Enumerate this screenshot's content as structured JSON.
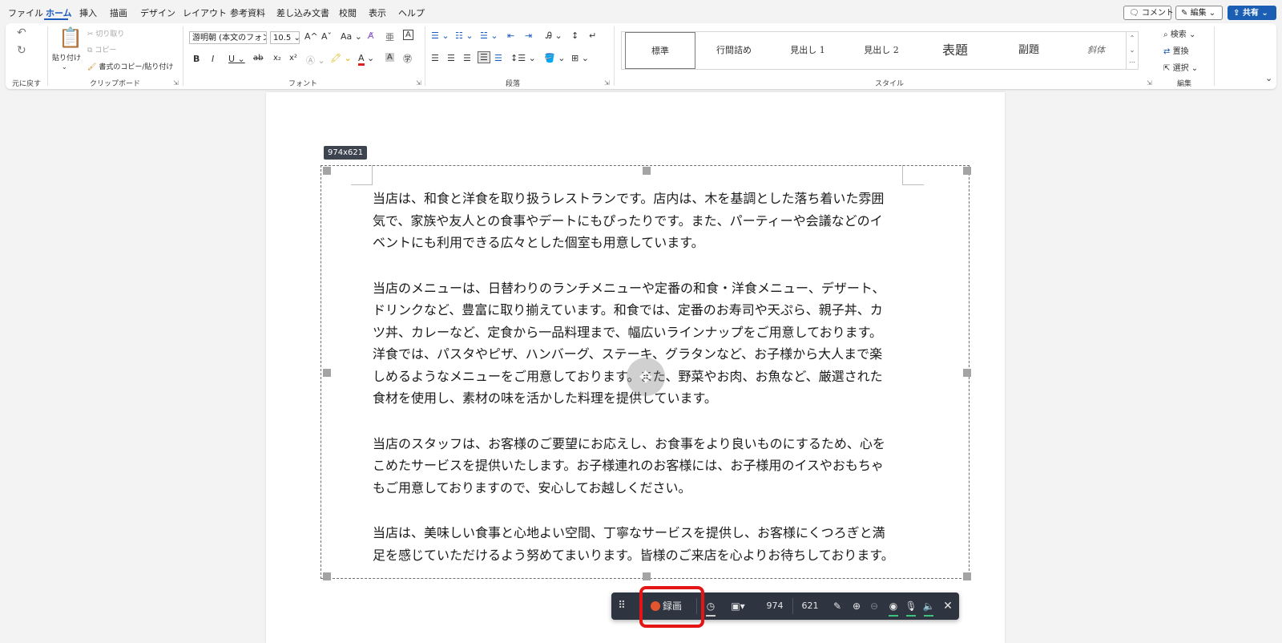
{
  "menu": {
    "tabs": [
      "ファイル",
      "ホーム",
      "挿入",
      "描画",
      "デザイン",
      "レイアウト",
      "参考資料",
      "差し込み文書",
      "校閲",
      "表示",
      "ヘルプ"
    ],
    "active_tab": "ホーム",
    "comment_label": "コメント",
    "edit_label": "編集",
    "share_label": "共有"
  },
  "ribbon": {
    "undo": {
      "label": "元に戻す"
    },
    "clipboard": {
      "paste_label": "貼り付け",
      "cut_label": "切り取り",
      "copy_label": "コピー",
      "format_painter_label": "書式のコピー/貼り付け",
      "group_label": "クリップボード"
    },
    "font": {
      "font_name": "游明朝 (本文のフォン",
      "font_size": "10.5",
      "group_label": "フォント",
      "buttons": [
        "A^",
        "Aˇ",
        "Aa",
        "B",
        "I",
        "U",
        "ab",
        "x₂",
        "x²",
        "A",
        "A"
      ]
    },
    "paragraph": {
      "group_label": "段落"
    },
    "styles": {
      "items": [
        "標準",
        "行間詰め",
        "見出し 1",
        "見出し 2",
        "表題",
        "副題",
        "斜体"
      ],
      "selected": "標準",
      "group_label": "スタイル"
    },
    "editing": {
      "find_label": "検索",
      "replace_label": "置換",
      "select_label": "選択",
      "group_label": "編集"
    }
  },
  "document": {
    "selection_size": "974x621",
    "paragraphs": [
      [
        "当店は、和食と洋食を取り扱うレストランです。店内は、木を基調とした落ち着いた雰囲",
        "気で、家族や友人との食事やデートにもぴったりです。また、パーティーや会議などのイ",
        "ベントにも利用できる広々とした個室も用意しています。"
      ],
      [
        "当店のメニューは、日替わりのランチメニューや定番の和食・洋食メニュー、デザート、",
        "ドリンクなど、豊富に取り揃えています。和食では、定番のお寿司や天ぷら、親子丼、カ",
        "ツ丼、カレーなど、定食から一品料理まで、幅広いラインナップをご用意しております。",
        "洋食では、パスタやピザ、ハンバーグ、ステーキ、グラタンなど、お子様から大人まで楽",
        "しめるようなメニューをご用意しております。また、野菜やお肉、お魚など、厳選された",
        "食材を使用し、素材の味を活かした料理を提供しています。"
      ],
      [
        "当店のスタッフは、お客様のご要望にお応えし、お食事をより良いものにするため、心を",
        "こめたサービスを提供いたします。お子様連れのお客様には、お子様用のイスやおもちゃ",
        "もご用意しておりますので、安心してお越しください。"
      ],
      [
        "当店は、美味しい食事と心地よい空間、丁寧なサービスを提供し、お客様にくつろぎと満",
        "足を感じていただけるよう努めてまいります。皆様のご来店を心よりお待ちしております。"
      ]
    ]
  },
  "recorder": {
    "record_label": "録画",
    "width_value": "974",
    "height_value": "621",
    "accent_color": "#e2552d",
    "highlight_color": "#e41515"
  }
}
